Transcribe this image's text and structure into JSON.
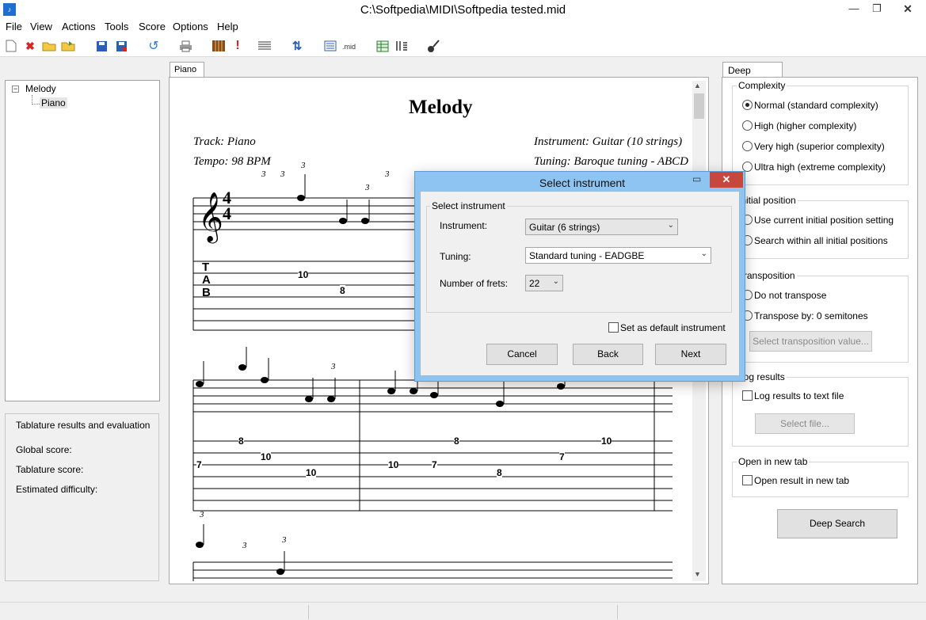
{
  "window": {
    "title": "C:\\Softpedia\\MIDI\\Softpedia tested.mid"
  },
  "menu": [
    "File",
    "View",
    "Actions",
    "Tools",
    "Score",
    "Options",
    "Help"
  ],
  "toolbar": {
    "mid_label": ".mid"
  },
  "tree": {
    "root": "Melody",
    "child": "Piano"
  },
  "results": {
    "title": "Tablature results and evaluation",
    "global_score": "Global score:",
    "tablature_score": "Tablature score:",
    "difficulty": "Estimated difficulty:"
  },
  "score": {
    "tab_label": "Piano",
    "title": "Melody",
    "track": "Track: Piano",
    "tempo": "Tempo: 98 BPM",
    "instrument": "Instrument: Guitar (10 strings)",
    "tuning": "Tuning: Baroque tuning - ABCD",
    "time_sig_top": "4",
    "time_sig_bottom": "4",
    "tab_letters": [
      "T",
      "A",
      "B"
    ],
    "triplet": "3",
    "system1_frets": [
      "10",
      "8"
    ],
    "system2_frets": [
      "8",
      "7",
      "10",
      "10",
      "10",
      "7",
      "8",
      "7",
      "8",
      "10"
    ]
  },
  "deep_search": {
    "tab_label": "Deep Search",
    "complexity": {
      "label": "Complexity",
      "options": [
        "Normal (standard complexity)",
        "High (higher complexity)",
        "Very high (superior complexity)",
        "Ultra high (extreme complexity)"
      ],
      "selected": 0
    },
    "initial_position": {
      "label": "Initial position",
      "options": [
        "Use current initial position setting",
        "Search within all initial positions"
      ]
    },
    "transposition": {
      "label": "Transposition",
      "options": [
        "Do not transpose",
        "Transpose by: 0 semitones"
      ],
      "button": "Select transposition value..."
    },
    "log": {
      "label": "Log results",
      "checkbox": "Log results to text file",
      "button": "Select file..."
    },
    "new_tab": {
      "label": "Open in new tab",
      "checkbox": "Open result in new tab"
    },
    "run_button": "Deep Search"
  },
  "dialog": {
    "title": "Select instrument",
    "group_label": "Select instrument",
    "instrument_label": "Instrument:",
    "instrument_value": "Guitar (6 strings)",
    "tuning_label": "Tuning:",
    "tuning_value": "Standard tuning - EADGBE",
    "frets_label": "Number of frets:",
    "frets_value": "22",
    "default_checkbox": "Set as default instrument",
    "cancel": "Cancel",
    "back": "Back",
    "next": "Next"
  },
  "colors": {
    "dialog_frame": "#8dc4f1",
    "close_button": "#c7473c",
    "accent": "#1e6fd0"
  }
}
